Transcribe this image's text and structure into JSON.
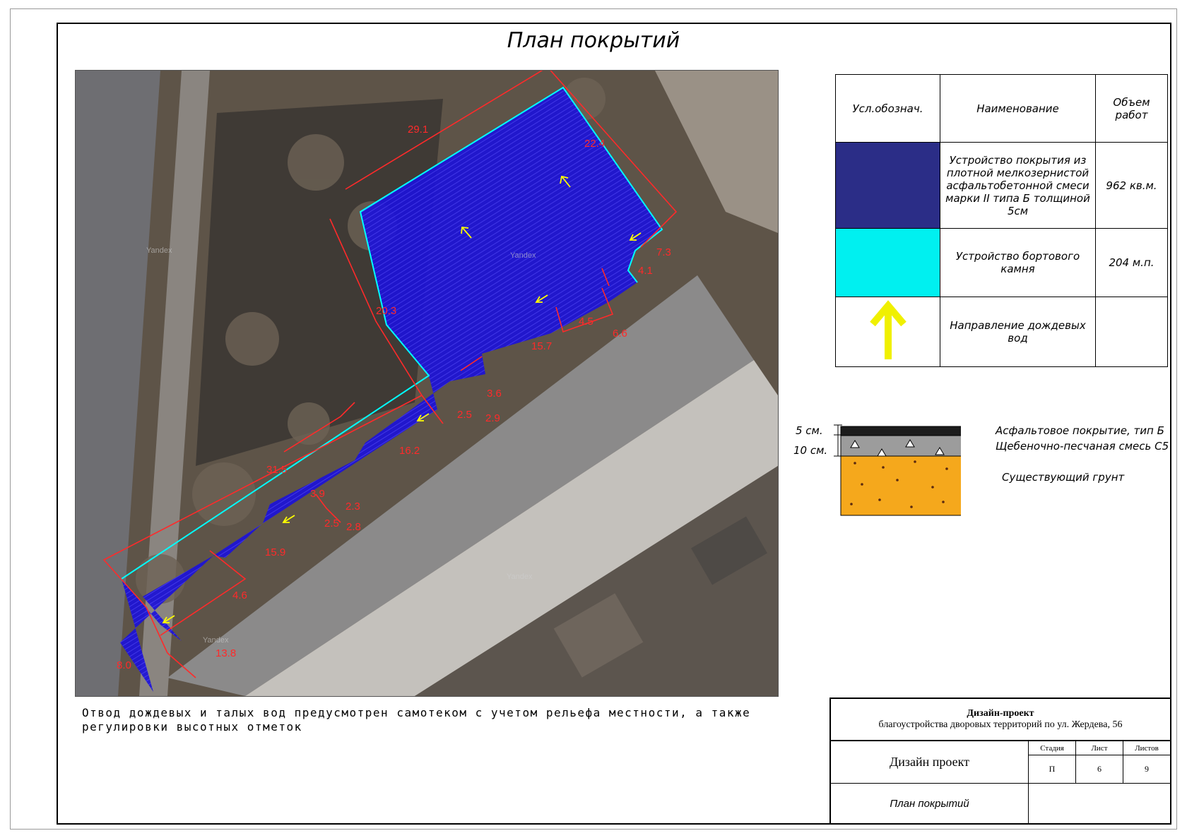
{
  "page": {
    "title": "План покрытий"
  },
  "legend": {
    "headers": {
      "symbol": "Усл.обознач.",
      "name": "Наименование",
      "volume": "Объем работ"
    },
    "rows": [
      {
        "color": "#2b2d87",
        "name": "Устройство покрытия из плотной мелкозернистой асфальтобетонной смеси марки II типа Б толщиной 5см",
        "volume": "962 кв.м."
      },
      {
        "color": "#00f0f0",
        "name": "Устройство бортового камня",
        "volume": "204 м.п."
      },
      {
        "icon": "yellow-arrow-up-icon",
        "color": "#f0f000",
        "name": "Направление дождевых вод",
        "volume": ""
      }
    ]
  },
  "layers": {
    "thickness_top": "5 см.",
    "thickness_bottom": "10 см.",
    "asphalt": "Асфальтовое покрытие, тип Б",
    "gravel": "Щебеночно-песчаная смесь С5",
    "soil": "Существующий грунт"
  },
  "note": "Отвод дождевых и талых вод предусмотрен самотеком с учетом рельефа местности, а также регулировки высотных отметок",
  "map": {
    "dimensions": [
      "29.1",
      "22.4",
      "7.3",
      "4.1",
      "6.6",
      "4.5",
      "15.7",
      "20.3",
      "3.6",
      "2.5",
      "2.9",
      "16.2",
      "31.5",
      "3.9",
      "2.3",
      "2.5",
      "2.8",
      "15.9",
      "4.6",
      "13.8",
      "8.0"
    ],
    "watermark": "Yandex"
  },
  "stamp": {
    "project_title": "Дизайн-проект",
    "project_subtitle": "благоустройства дворовых территорий по ул. Жердева, 56",
    "design": "Дизайн проект",
    "sheet_name": "План покрытий",
    "col_stage": "Стадия",
    "col_sheet": "Лист",
    "col_sheets": "Листов",
    "stage": "П",
    "sheet": "6",
    "sheets": "9"
  },
  "colors": {
    "asphalt_fill": "#1a10e0",
    "curb": "#00ffff",
    "dimension": "#ff2020",
    "arrow": "#ffff00"
  }
}
